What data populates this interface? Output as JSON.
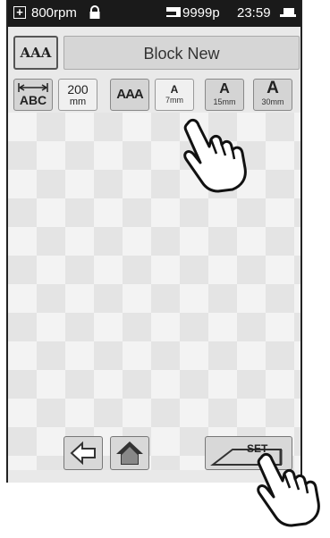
{
  "status": {
    "speed": "800rpm",
    "stitches": "9999p",
    "time": "23:59"
  },
  "font_button": {
    "label": "AAA"
  },
  "pattern_name": "Block New",
  "toolbar": {
    "spacing": {
      "label": "ABC"
    },
    "width": {
      "value": "200",
      "unit": "mm"
    },
    "style": {
      "label": "AAA"
    },
    "size_small": {
      "letter": "A",
      "size": "7mm"
    },
    "size_medium": {
      "letter": "A",
      "size": "15mm"
    },
    "size_large": {
      "letter": "A",
      "size": "30mm"
    }
  },
  "set_button": {
    "label": "SET"
  },
  "icons": [
    "plus-icon",
    "lock-icon",
    "machine-icon",
    "usb-icon",
    "back-icon",
    "home-icon",
    "hand-pointer-icon"
  ]
}
